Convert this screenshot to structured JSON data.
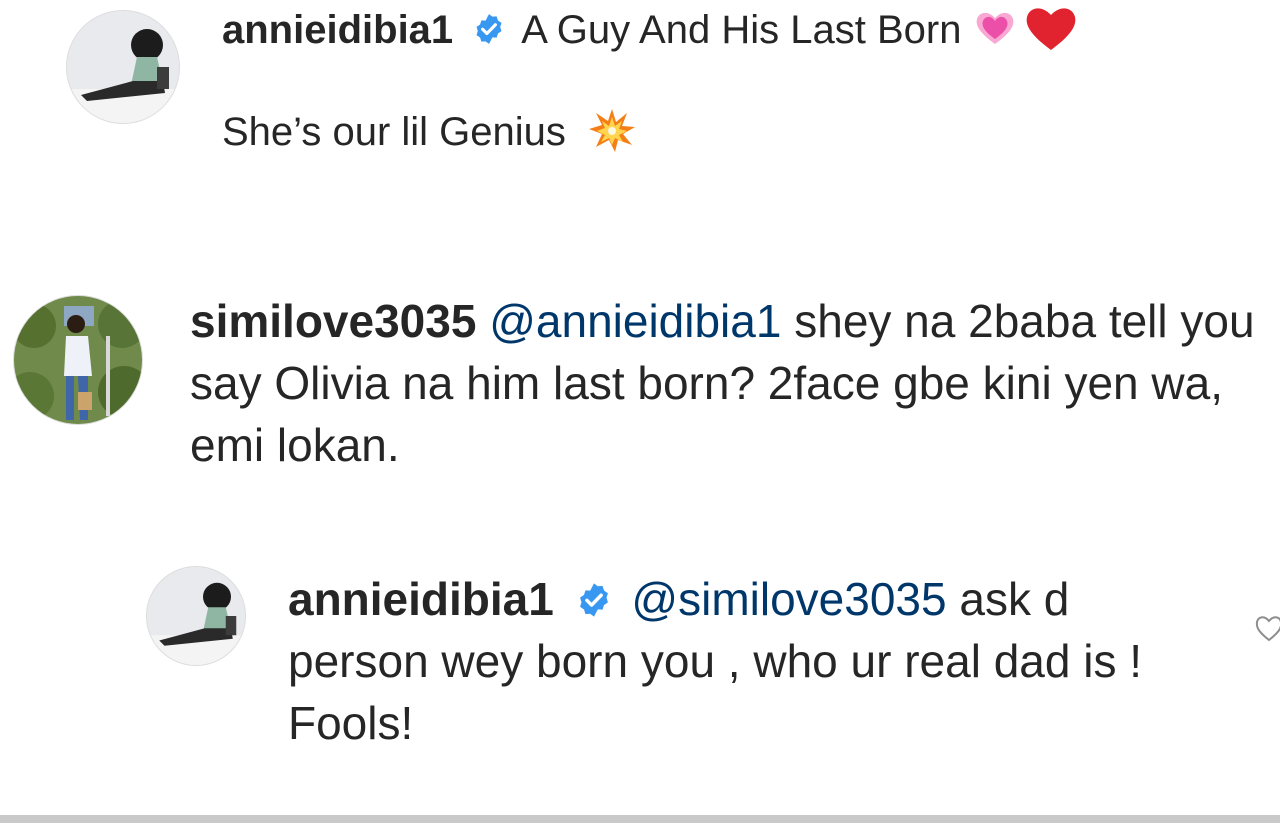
{
  "post": {
    "author": "annieidibia1",
    "verified": true,
    "caption_line1": "A Guy And His Last Born",
    "caption_line1_emojis": [
      "growing-heart-emoji",
      "red-heart-emoji"
    ],
    "caption_line2": "She’s our lil Genius",
    "caption_line2_emoji": "collision-emoji"
  },
  "comment": {
    "author": "similove3035",
    "mention": "@annieidibia1",
    "text": " shey na 2baba tell you say Olivia na him last born? 2face gbe kini yen wa, emi lokan."
  },
  "reply": {
    "author": "annieidibia1",
    "verified": true,
    "mention": "@similove3035",
    "text": " ask d person wey born you , who ur real dad is !  Fools!",
    "like_icon": "heart-outline-icon"
  },
  "colors": {
    "text": "#262626",
    "mention": "#00376b",
    "verified_badge": "#3897f0",
    "background": "#ffffff"
  }
}
